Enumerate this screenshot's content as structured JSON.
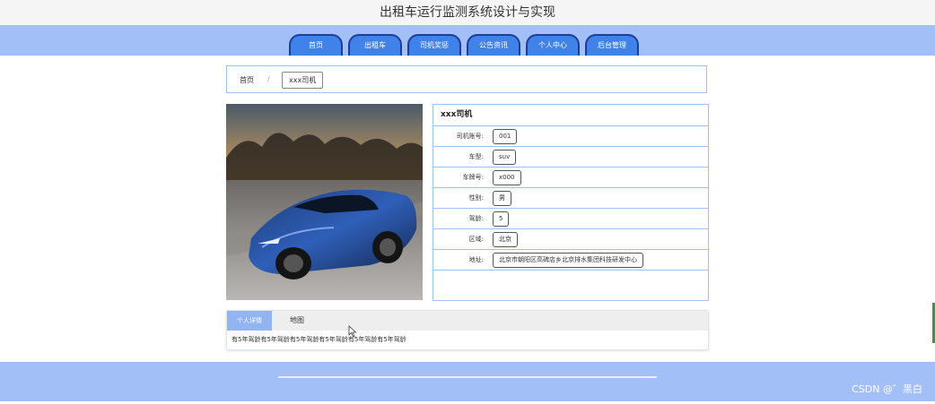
{
  "header": {
    "title": "出租车运行监测系统设计与实现"
  },
  "nav": {
    "tabs": [
      "首页",
      "出租车",
      "司机奖惩",
      "公告资讯",
      "个人中心",
      "后台管理"
    ]
  },
  "breadcrumb": {
    "home": "首页",
    "separator": "/",
    "current": "xxx司机"
  },
  "driver": {
    "name": "xxx司机",
    "fields": [
      {
        "label": "司机账号:",
        "value": "001"
      },
      {
        "label": "车型:",
        "value": "suv"
      },
      {
        "label": "车牌号:",
        "value": "x000"
      },
      {
        "label": "性别:",
        "value": "男"
      },
      {
        "label": "驾龄:",
        "value": "5"
      },
      {
        "label": "区域:",
        "value": "北京"
      },
      {
        "label": "地址:",
        "value": "北京市朝阳区高碑店乡北京排水集团科技研发中心"
      }
    ]
  },
  "detail_tabs": {
    "active": "个人详情",
    "other": "地图",
    "content": "有5年驾龄有5年驾龄有5年驾龄有5年驾龄有5年驾龄有5年驾龄"
  },
  "footer": {
    "watermark": "CSDN @゛黑白"
  },
  "colors": {
    "band": "#a3bff7",
    "tab": "#3f82ea",
    "tab_border": "#1f3c96",
    "active_tab": "#93b4f2"
  },
  "icons": {
    "cursor": "mouse-pointer-icon"
  }
}
